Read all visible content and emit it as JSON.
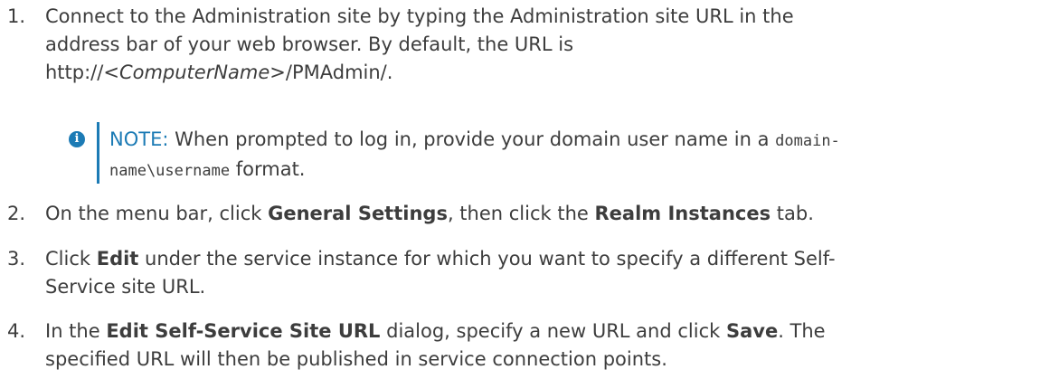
{
  "steps": [
    {
      "number": "1.",
      "lines": [
        "Connect to the Administration site by typing the Administration site URL in the",
        "address bar of your web browser. By default, the URL is"
      ],
      "url_prefix": "http://<",
      "url_placeholder": "ComputerName",
      "url_suffix": ">/PMAdmin/."
    },
    {
      "number": "2.",
      "text_1": "On the menu bar, click ",
      "bold_1": "General Settings",
      "text_2": ", then click the ",
      "bold_2": "Realm Instances",
      "text_3": " tab."
    },
    {
      "number": "3.",
      "text_1": "Click ",
      "bold_1": "Edit",
      "text_2": " under the service instance for which you want to specify a different Self-",
      "line_2": "Service site URL."
    },
    {
      "number": "4.",
      "text_1": "In the ",
      "bold_1": "Edit Self-Service Site URL",
      "text_2": " dialog, specify a new URL and click ",
      "bold_2": "Save",
      "text_3": ". The",
      "line_2": "specified URL will then be published in service connection points."
    }
  ],
  "note": {
    "icon": "info-icon",
    "label": "NOTE:",
    "text_1": " When prompted to log in, provide your domain user name in a ",
    "code_1": "domain-",
    "code_2": "name\\username",
    "text_2": " format."
  },
  "colors": {
    "text": "#3d3d3d",
    "accent": "#1c7bb5"
  }
}
